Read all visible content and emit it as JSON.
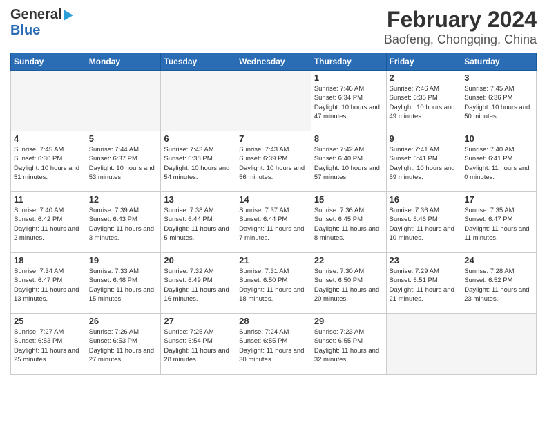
{
  "header": {
    "logo_general": "General",
    "logo_blue": "Blue",
    "main_title": "February 2024",
    "subtitle": "Baofeng, Chongqing, China"
  },
  "days_of_week": [
    "Sunday",
    "Monday",
    "Tuesday",
    "Wednesday",
    "Thursday",
    "Friday",
    "Saturday"
  ],
  "weeks": [
    [
      {
        "day": "",
        "empty": true
      },
      {
        "day": "",
        "empty": true
      },
      {
        "day": "",
        "empty": true
      },
      {
        "day": "",
        "empty": true
      },
      {
        "day": "1",
        "sunrise": "7:46 AM",
        "sunset": "6:34 PM",
        "daylight": "10 hours and 47 minutes."
      },
      {
        "day": "2",
        "sunrise": "7:46 AM",
        "sunset": "6:35 PM",
        "daylight": "10 hours and 49 minutes."
      },
      {
        "day": "3",
        "sunrise": "7:45 AM",
        "sunset": "6:36 PM",
        "daylight": "10 hours and 50 minutes."
      }
    ],
    [
      {
        "day": "4",
        "sunrise": "7:45 AM",
        "sunset": "6:36 PM",
        "daylight": "10 hours and 51 minutes."
      },
      {
        "day": "5",
        "sunrise": "7:44 AM",
        "sunset": "6:37 PM",
        "daylight": "10 hours and 53 minutes."
      },
      {
        "day": "6",
        "sunrise": "7:43 AM",
        "sunset": "6:38 PM",
        "daylight": "10 hours and 54 minutes."
      },
      {
        "day": "7",
        "sunrise": "7:43 AM",
        "sunset": "6:39 PM",
        "daylight": "10 hours and 56 minutes."
      },
      {
        "day": "8",
        "sunrise": "7:42 AM",
        "sunset": "6:40 PM",
        "daylight": "10 hours and 57 minutes."
      },
      {
        "day": "9",
        "sunrise": "7:41 AM",
        "sunset": "6:41 PM",
        "daylight": "10 hours and 59 minutes."
      },
      {
        "day": "10",
        "sunrise": "7:40 AM",
        "sunset": "6:41 PM",
        "daylight": "11 hours and 0 minutes."
      }
    ],
    [
      {
        "day": "11",
        "sunrise": "7:40 AM",
        "sunset": "6:42 PM",
        "daylight": "11 hours and 2 minutes."
      },
      {
        "day": "12",
        "sunrise": "7:39 AM",
        "sunset": "6:43 PM",
        "daylight": "11 hours and 3 minutes."
      },
      {
        "day": "13",
        "sunrise": "7:38 AM",
        "sunset": "6:44 PM",
        "daylight": "11 hours and 5 minutes."
      },
      {
        "day": "14",
        "sunrise": "7:37 AM",
        "sunset": "6:44 PM",
        "daylight": "11 hours and 7 minutes."
      },
      {
        "day": "15",
        "sunrise": "7:36 AM",
        "sunset": "6:45 PM",
        "daylight": "11 hours and 8 minutes."
      },
      {
        "day": "16",
        "sunrise": "7:36 AM",
        "sunset": "6:46 PM",
        "daylight": "11 hours and 10 minutes."
      },
      {
        "day": "17",
        "sunrise": "7:35 AM",
        "sunset": "6:47 PM",
        "daylight": "11 hours and 11 minutes."
      }
    ],
    [
      {
        "day": "18",
        "sunrise": "7:34 AM",
        "sunset": "6:47 PM",
        "daylight": "11 hours and 13 minutes."
      },
      {
        "day": "19",
        "sunrise": "7:33 AM",
        "sunset": "6:48 PM",
        "daylight": "11 hours and 15 minutes."
      },
      {
        "day": "20",
        "sunrise": "7:32 AM",
        "sunset": "6:49 PM",
        "daylight": "11 hours and 16 minutes."
      },
      {
        "day": "21",
        "sunrise": "7:31 AM",
        "sunset": "6:50 PM",
        "daylight": "11 hours and 18 minutes."
      },
      {
        "day": "22",
        "sunrise": "7:30 AM",
        "sunset": "6:50 PM",
        "daylight": "11 hours and 20 minutes."
      },
      {
        "day": "23",
        "sunrise": "7:29 AM",
        "sunset": "6:51 PM",
        "daylight": "11 hours and 21 minutes."
      },
      {
        "day": "24",
        "sunrise": "7:28 AM",
        "sunset": "6:52 PM",
        "daylight": "11 hours and 23 minutes."
      }
    ],
    [
      {
        "day": "25",
        "sunrise": "7:27 AM",
        "sunset": "6:53 PM",
        "daylight": "11 hours and 25 minutes."
      },
      {
        "day": "26",
        "sunrise": "7:26 AM",
        "sunset": "6:53 PM",
        "daylight": "11 hours and 27 minutes."
      },
      {
        "day": "27",
        "sunrise": "7:25 AM",
        "sunset": "6:54 PM",
        "daylight": "11 hours and 28 minutes."
      },
      {
        "day": "28",
        "sunrise": "7:24 AM",
        "sunset": "6:55 PM",
        "daylight": "11 hours and 30 minutes."
      },
      {
        "day": "29",
        "sunrise": "7:23 AM",
        "sunset": "6:55 PM",
        "daylight": "11 hours and 32 minutes."
      },
      {
        "day": "",
        "empty": true
      },
      {
        "day": "",
        "empty": true
      }
    ]
  ]
}
